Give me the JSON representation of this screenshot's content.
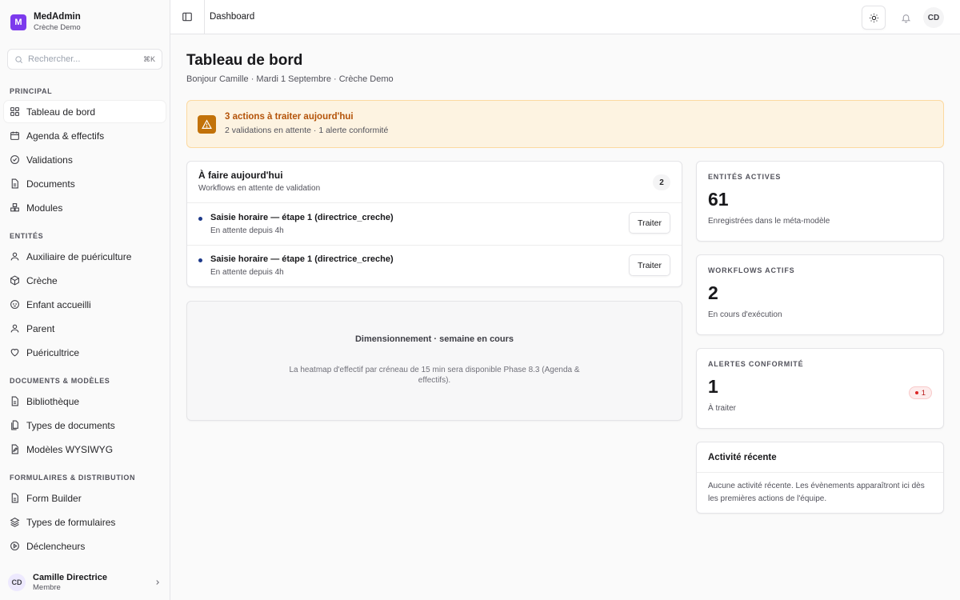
{
  "brand": {
    "logo_letter": "M",
    "name": "MedAdmin",
    "sub": "Crèche Demo",
    "color": "#7c3aed"
  },
  "search": {
    "placeholder": "Rechercher...",
    "shortcut": "⌘K"
  },
  "sidebar": {
    "sections": [
      {
        "label": "PRINCIPAL",
        "items": [
          {
            "label": "Tableau de bord",
            "icon": "grid-icon",
            "active": true
          },
          {
            "label": "Agenda & effectifs",
            "icon": "calendar-icon"
          },
          {
            "label": "Validations",
            "icon": "check-circle-icon"
          },
          {
            "label": "Documents",
            "icon": "file-icon"
          },
          {
            "label": "Modules",
            "icon": "boxes-icon"
          }
        ]
      },
      {
        "label": "ENTITÉS",
        "items": [
          {
            "label": "Auxiliaire de puériculture",
            "icon": "user-icon"
          },
          {
            "label": "Crèche",
            "icon": "box-icon"
          },
          {
            "label": "Enfant accueilli",
            "icon": "baby-icon"
          },
          {
            "label": "Parent",
            "icon": "user-icon"
          },
          {
            "label": "Puéricultrice",
            "icon": "heart-icon"
          }
        ]
      },
      {
        "label": "DOCUMENTS & MODÈLES",
        "items": [
          {
            "label": "Bibliothèque",
            "icon": "file-icon"
          },
          {
            "label": "Types de documents",
            "icon": "files-icon"
          },
          {
            "label": "Modèles WYSIWYG",
            "icon": "file-edit-icon"
          }
        ]
      },
      {
        "label": "FORMULAIRES & DISTRIBUTION",
        "items": [
          {
            "label": "Form Builder",
            "icon": "file-icon"
          },
          {
            "label": "Types de formulaires",
            "icon": "layers-icon"
          },
          {
            "label": "Déclencheurs",
            "icon": "play-circle-icon"
          }
        ]
      }
    ]
  },
  "user": {
    "initials": "CD",
    "name": "Camille Directrice",
    "role": "Membre"
  },
  "topbar": {
    "breadcrumb": "Dashboard",
    "avatar_initials": "CD"
  },
  "page": {
    "title": "Tableau de bord",
    "subtitle": "Bonjour Camille · Mardi 1 Septembre · Crèche Demo"
  },
  "alert": {
    "title": "3 actions à traiter aujourd'hui",
    "desc": "2 validations en attente · 1 alerte conformité",
    "color": "#b45309"
  },
  "todo": {
    "title": "À faire aujourd'hui",
    "sub": "Workflows en attente de validation",
    "count": "2",
    "rows": [
      {
        "title": "Saisie horaire — étape 1 (directrice_creche)",
        "sub": "En attente depuis 4h",
        "button": "Traiter"
      },
      {
        "title": "Saisie horaire — étape 1 (directrice_creche)",
        "sub": "En attente depuis 4h",
        "button": "Traiter"
      }
    ]
  },
  "heatmap": {
    "title": "Dimensionnement · semaine en cours",
    "desc": "La heatmap d'effectif par créneau de 15 min sera disponible Phase 8.3 (Agenda & effectifs)."
  },
  "stats": [
    {
      "label": "ENTITÉS ACTIVES",
      "value": "61",
      "note": "Enregistrées dans le méta-modèle"
    },
    {
      "label": "WORKFLOWS ACTIFS",
      "value": "2",
      "note": "En cours d'exécution"
    },
    {
      "label": "ALERTES CONFORMITÉ",
      "value": "1",
      "note": "À traiter",
      "badge": "1"
    }
  ],
  "activity": {
    "title": "Activité récente",
    "body": "Aucune activité récente. Les évènements apparaîtront ici dès les premières actions de l'équipe."
  }
}
